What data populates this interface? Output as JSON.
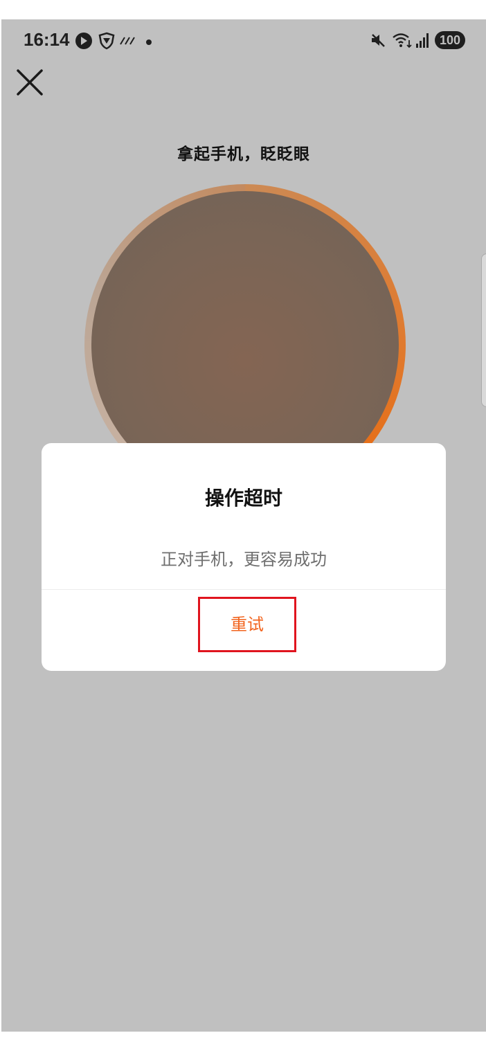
{
  "status_bar": {
    "time": "16:14",
    "battery": "100",
    "icons": [
      "vpn-icon",
      "shield-icon",
      "no-sim-icon",
      "dot-icon",
      "mute-icon",
      "wifi-icon",
      "signal-icon",
      "battery-icon"
    ]
  },
  "header": {
    "close_icon": "close-icon"
  },
  "page": {
    "headline": "拿起手机，眨眨眼"
  },
  "dialog": {
    "title": "操作超时",
    "message": "正对手机，更容易成功",
    "retry_label": "重试"
  },
  "colors": {
    "overlay_bg": "#c0c0c0",
    "accent": "#f2641e",
    "highlight_border": "#e0141e",
    "dialog_bg": "#ffffff"
  }
}
